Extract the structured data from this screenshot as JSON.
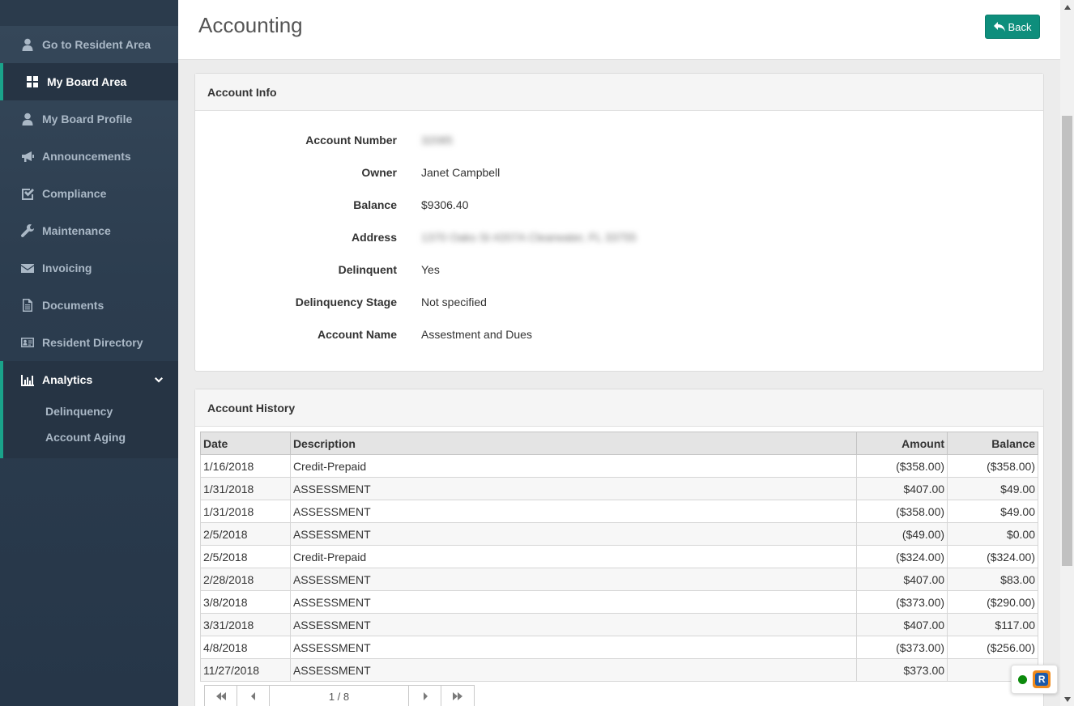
{
  "sidebar": {
    "items": [
      {
        "label": "Go to Resident Area",
        "icon": "user-icon"
      },
      {
        "label": "My Board Area",
        "icon": "grid-icon"
      },
      {
        "label": "My Board Profile",
        "icon": "user-icon"
      },
      {
        "label": "Announcements",
        "icon": "megaphone-icon"
      },
      {
        "label": "Compliance",
        "icon": "checkbox-icon"
      },
      {
        "label": "Maintenance",
        "icon": "wrench-icon"
      },
      {
        "label": "Invoicing",
        "icon": "envelope-icon"
      },
      {
        "label": "Documents",
        "icon": "document-icon"
      },
      {
        "label": "Resident Directory",
        "icon": "id-card-icon"
      }
    ],
    "active_item": "My Board Area",
    "analytics": {
      "label": "Analytics",
      "icon": "bar-chart-icon",
      "sub_items": [
        {
          "label": "Delinquency"
        },
        {
          "label": "Account Aging"
        }
      ]
    }
  },
  "header": {
    "title": "Accounting",
    "back_label": "Back"
  },
  "account_info": {
    "title": "Account Info",
    "rows": [
      {
        "label": "Account Number",
        "value": "32085"
      },
      {
        "label": "Owner",
        "value": "Janet Campbell"
      },
      {
        "label": "Balance",
        "value": "$9306.40"
      },
      {
        "label": "Address",
        "value": "1370 Oaks St #207A Clearwater, FL 33755"
      },
      {
        "label": "Delinquent",
        "value": "Yes"
      },
      {
        "label": "Delinquency Stage",
        "value": "Not specified"
      },
      {
        "label": "Account Name",
        "value": "Assestment and Dues"
      }
    ]
  },
  "account_history": {
    "title": "Account History",
    "columns": [
      "Date",
      "Description",
      "Amount",
      "Balance"
    ],
    "rows": [
      {
        "date": "1/16/2018",
        "description": "Credit-Prepaid",
        "amount": "($358.00)",
        "balance": "($358.00)"
      },
      {
        "date": "1/31/2018",
        "description": "ASSESSMENT",
        "amount": "$407.00",
        "balance": "$49.00"
      },
      {
        "date": "1/31/2018",
        "description": "ASSESSMENT",
        "amount": "($358.00)",
        "balance": "$49.00"
      },
      {
        "date": "2/5/2018",
        "description": "ASSESSMENT",
        "amount": "($49.00)",
        "balance": "$0.00"
      },
      {
        "date": "2/5/2018",
        "description": "Credit-Prepaid",
        "amount": "($324.00)",
        "balance": "($324.00)"
      },
      {
        "date": "2/28/2018",
        "description": "ASSESSMENT",
        "amount": "$407.00",
        "balance": "$83.00"
      },
      {
        "date": "3/8/2018",
        "description": "ASSESSMENT",
        "amount": "($373.00)",
        "balance": "($290.00)"
      },
      {
        "date": "3/31/2018",
        "description": "ASSESSMENT",
        "amount": "$407.00",
        "balance": "$117.00"
      },
      {
        "date": "4/8/2018",
        "description": "ASSESSMENT",
        "amount": "($373.00)",
        "balance": "($256.00)"
      },
      {
        "date": "11/27/2018",
        "description": "ASSESSMENT",
        "amount": "$373.00",
        "balance": "$11"
      }
    ],
    "pager": {
      "page_info": "1 / 8"
    }
  },
  "widget": {
    "logo_letter": "R",
    "status_color": "#0c8a0c"
  },
  "colors": {
    "accent": "#1aa38a",
    "back_button": "#0e8e7c",
    "sidebar": "#2c3d4f"
  }
}
